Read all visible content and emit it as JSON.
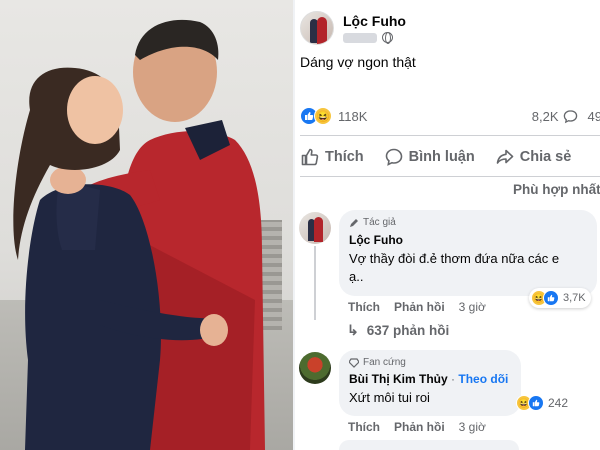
{
  "post": {
    "author": "Lộc Fuho",
    "caption": "Dáng vợ ngon thật",
    "reaction_count": "118K",
    "comment_count": "8,2K",
    "share_count": "49"
  },
  "actions": {
    "like": "Thích",
    "comment": "Bình luận",
    "share": "Chia sẻ"
  },
  "sort_label": "Phù hợp nhất",
  "comments": [
    {
      "badge": "Tác giả",
      "name": "Lộc Fuho",
      "text_line1": "Vợ thầy đòi đ.ẻ thơm đứa nữa các e",
      "text_line2": "ạ..",
      "like_label": "Thích",
      "reply_label": "Phản hồi",
      "time": "3 giờ",
      "reaction_count": "3,7K",
      "replies_label": "637 phản hồi"
    },
    {
      "badge": "Fan cứng",
      "name": "Bùi Thị Kim Thủy",
      "follow_label": "Theo dõi",
      "text": "Xứt môi tui roi",
      "like_label": "Thích",
      "reply_label": "Phản hồi",
      "time": "3 giờ",
      "reaction_count": "242"
    }
  ],
  "colors": {
    "accent": "#1877f2",
    "muted_text": "#65676b",
    "bubble_bg": "#f0f2f5",
    "haha_yellow": "#f7c53d"
  }
}
